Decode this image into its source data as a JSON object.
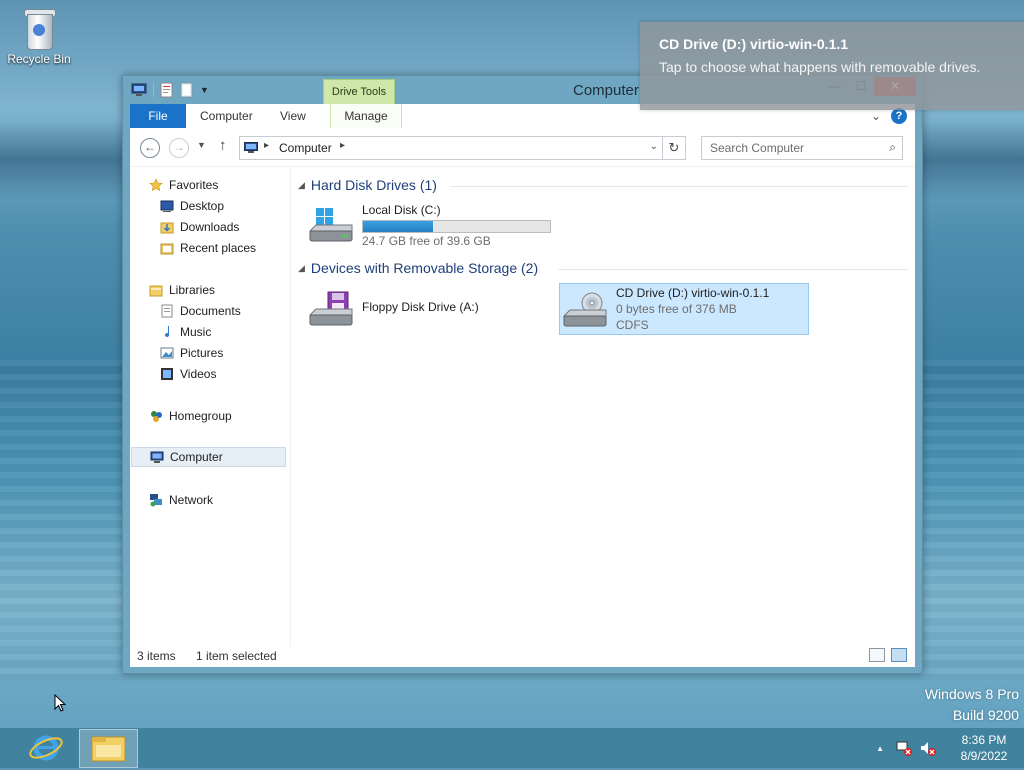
{
  "desktop": {
    "recycle_bin_label": "Recycle Bin",
    "watermark_line1": "Windows 8 Pro",
    "watermark_line2": "Build 9200"
  },
  "toast": {
    "title": "CD Drive (D:) virtio-win-0.1.1",
    "message": "Tap to choose what happens with removable drives."
  },
  "window": {
    "title": "Computer",
    "contextual_tab_group": "Drive Tools",
    "tabs": {
      "file": "File",
      "computer": "Computer",
      "view": "View",
      "manage": "Manage"
    },
    "caption": {
      "minimize": "—",
      "maximize": "☐",
      "close": "✕"
    },
    "address": {
      "crumb": "Computer"
    },
    "search": {
      "placeholder": "Search Computer"
    },
    "nav": {
      "favorites": "Favorites",
      "desktop": "Desktop",
      "downloads": "Downloads",
      "recent": "Recent places",
      "libraries": "Libraries",
      "documents": "Documents",
      "music": "Music",
      "pictures": "Pictures",
      "videos": "Videos",
      "homegroup": "Homegroup",
      "computer": "Computer",
      "network": "Network"
    },
    "groups": {
      "hdd": "Hard Disk Drives (1)",
      "removable": "Devices with Removable Storage (2)"
    },
    "drives": {
      "c": {
        "name": "Local Disk (C:)",
        "free": "24.7 GB free of 39.6 GB",
        "used_fraction": 0.376
      },
      "a": {
        "name": "Floppy Disk Drive (A:)"
      },
      "d": {
        "name": "CD Drive (D:) virtio-win-0.1.1",
        "free": "0 bytes free of 376 MB",
        "fs": "CDFS"
      }
    },
    "status": {
      "items": "3 items",
      "selected": "1 item selected"
    }
  },
  "taskbar": {
    "time": "8:36 PM",
    "date": "8/9/2022"
  },
  "colors": {
    "accent": "#1a73c9",
    "selection": "#cce8ff",
    "drive_tools": "#cfe8a9",
    "close": "#c7504b"
  }
}
